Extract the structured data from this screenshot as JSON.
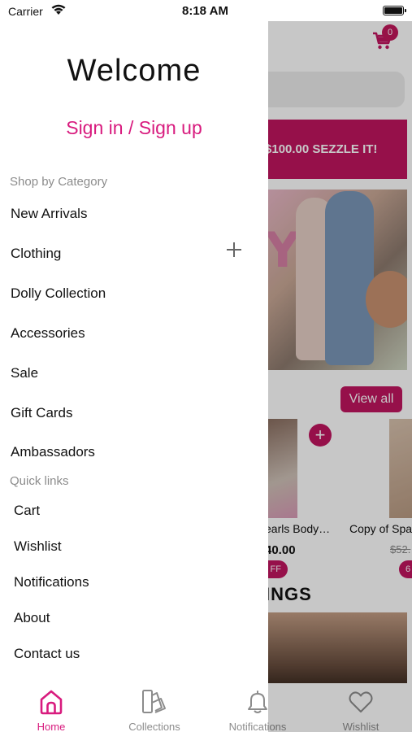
{
  "status_bar": {
    "carrier": "Carrier",
    "time": "8:18 AM"
  },
  "drawer": {
    "welcome": "Welcome",
    "sign_in_link": "Sign in / Sign up",
    "shop_by_category_title": "Shop by Category",
    "categories": [
      "New Arrivals",
      "Clothing",
      "Dolly Collection",
      "Accessories",
      "Sale",
      "Gift Cards",
      "Ambassadors"
    ],
    "quick_links_title": "Quick links",
    "quick_links": [
      "Cart",
      "Wishlist",
      "Notifications",
      "About",
      "Contact us"
    ]
  },
  "background": {
    "cart_count": "0",
    "promo_banner": "r $100.00 SEZZLE IT!",
    "view_all": "View all",
    "product_1": {
      "name": "earls Body…",
      "price": "40.00",
      "badge": "FF"
    },
    "product_2": {
      "name": "Copy of Spa",
      "price": "$52.",
      "badge": "6"
    },
    "section_heading": "INGS",
    "brand_color": "#c0155f"
  },
  "tabbar": {
    "items": [
      {
        "label": "Home",
        "icon": "home-icon",
        "active": true
      },
      {
        "label": "Collections",
        "icon": "collections-icon",
        "active": false
      },
      {
        "label": "Notifications",
        "icon": "bell-icon",
        "active": false
      },
      {
        "label": "Wishlist",
        "icon": "heart-icon",
        "active": false
      }
    ],
    "active_color": "#d81b7e"
  }
}
